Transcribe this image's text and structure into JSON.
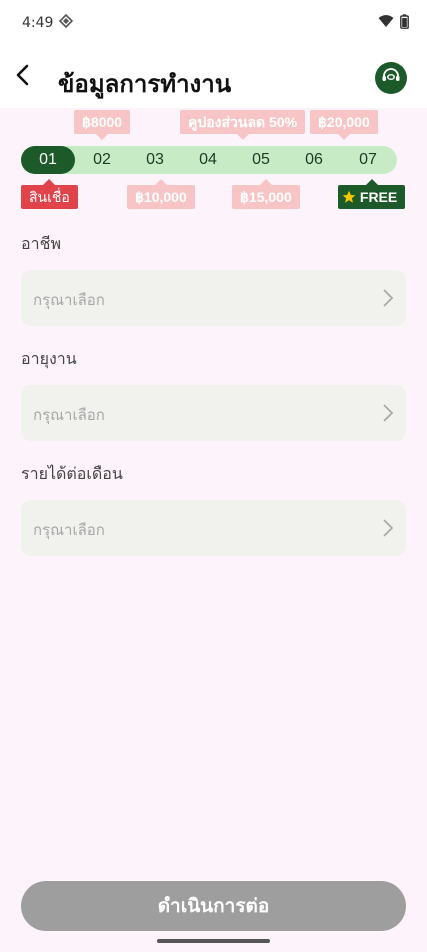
{
  "status_bar": {
    "time": "4:49"
  },
  "header": {
    "title": "ข้อมูลการทำงาน"
  },
  "steps": {
    "items": [
      "01",
      "02",
      "03",
      "04",
      "05",
      "06",
      "07"
    ],
    "active_index": 0,
    "top_tags": [
      "฿8000",
      "คูปองส่วนลด 50%",
      "฿20,000"
    ],
    "bottom_tags": [
      "สินเชื่อ",
      "฿10,000",
      "฿15,000",
      "FREE"
    ]
  },
  "form": {
    "fields": [
      {
        "label": "อาชีพ",
        "placeholder": "กรุณาเลือก"
      },
      {
        "label": "อายุงาน",
        "placeholder": "กรุณาเลือก"
      },
      {
        "label": "รายได้ต่อเดือน",
        "placeholder": "กรุณาเลือก"
      }
    ]
  },
  "footer": {
    "continue_label": "ดำเนินการต่อ"
  },
  "colors": {
    "brand_green": "#1d5a2a",
    "step_light": "#c7ecc5",
    "tag_pink": "#f7c5c5",
    "tag_red": "#e0434a",
    "button_disabled": "#9e9e9e",
    "background": "#fdf4fb"
  },
  "icons": {
    "back": "arrow-left-icon",
    "support": "headset-icon",
    "chevron": "chevron-right-icon",
    "star": "star-icon",
    "wifi": "wifi-icon",
    "battery": "battery-icon"
  }
}
